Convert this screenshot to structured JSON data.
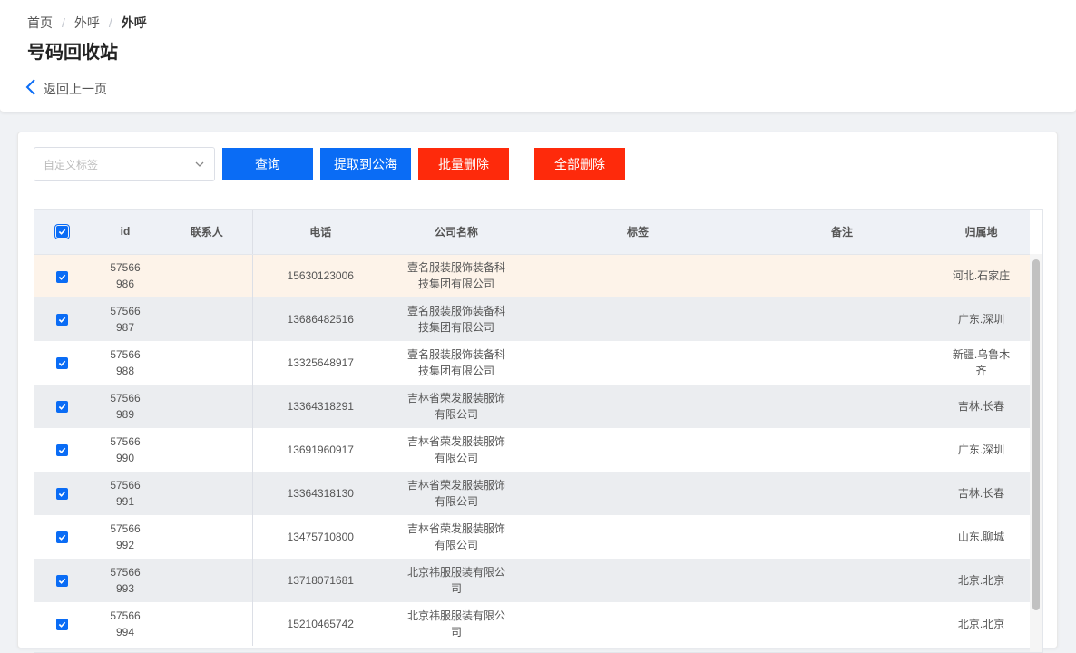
{
  "breadcrumb": [
    "首页",
    "外呼",
    "外呼"
  ],
  "page_title": "号码回收站",
  "back_label": "返回上一页",
  "toolbar": {
    "tag_select_placeholder": "自定义标签",
    "query_label": "查询",
    "extract_label": "提取到公海",
    "batch_delete_label": "批量删除",
    "delete_all_label": "全部删除"
  },
  "colors": {
    "primary": "#0a6cf5",
    "danger": "#fe2a0b",
    "row_highlight": "#fdf3e9"
  },
  "table": {
    "columns": [
      "id",
      "联系人",
      "电话",
      "公司名称",
      "标签",
      "备注",
      "归属地"
    ],
    "rows": [
      {
        "id": "57566\n986",
        "contact": "",
        "phone": "15630123006",
        "company": "壹名服装服饰装备科\n技集团有限公司",
        "tag": "",
        "note": "",
        "location": "河北.石家庄",
        "checked": true
      },
      {
        "id": "57566\n987",
        "contact": "",
        "phone": "13686482516",
        "company": "壹名服装服饰装备科\n技集团有限公司",
        "tag": "",
        "note": "",
        "location": "广东.深圳",
        "checked": true
      },
      {
        "id": "57566\n988",
        "contact": "",
        "phone": "13325648917",
        "company": "壹名服装服饰装备科\n技集团有限公司",
        "tag": "",
        "note": "",
        "location": "新疆.乌鲁木\n齐",
        "checked": true
      },
      {
        "id": "57566\n989",
        "contact": "",
        "phone": "13364318291",
        "company": "吉林省荣发服装服饰\n有限公司",
        "tag": "",
        "note": "",
        "location": "吉林.长春",
        "checked": true
      },
      {
        "id": "57566\n990",
        "contact": "",
        "phone": "13691960917",
        "company": "吉林省荣发服装服饰\n有限公司",
        "tag": "",
        "note": "",
        "location": "广东.深圳",
        "checked": true
      },
      {
        "id": "57566\n991",
        "contact": "",
        "phone": "13364318130",
        "company": "吉林省荣发服装服饰\n有限公司",
        "tag": "",
        "note": "",
        "location": "吉林.长春",
        "checked": true
      },
      {
        "id": "57566\n992",
        "contact": "",
        "phone": "13475710800",
        "company": "吉林省荣发服装服饰\n有限公司",
        "tag": "",
        "note": "",
        "location": "山东.聊城",
        "checked": true
      },
      {
        "id": "57566\n993",
        "contact": "",
        "phone": "13718071681",
        "company": "北京祎服服装有限公\n司",
        "tag": "",
        "note": "",
        "location": "北京.北京",
        "checked": true
      },
      {
        "id": "57566\n994",
        "contact": "",
        "phone": "15210465742",
        "company": "北京祎服服装有限公\n司",
        "tag": "",
        "note": "",
        "location": "北京.北京",
        "checked": true
      }
    ]
  }
}
